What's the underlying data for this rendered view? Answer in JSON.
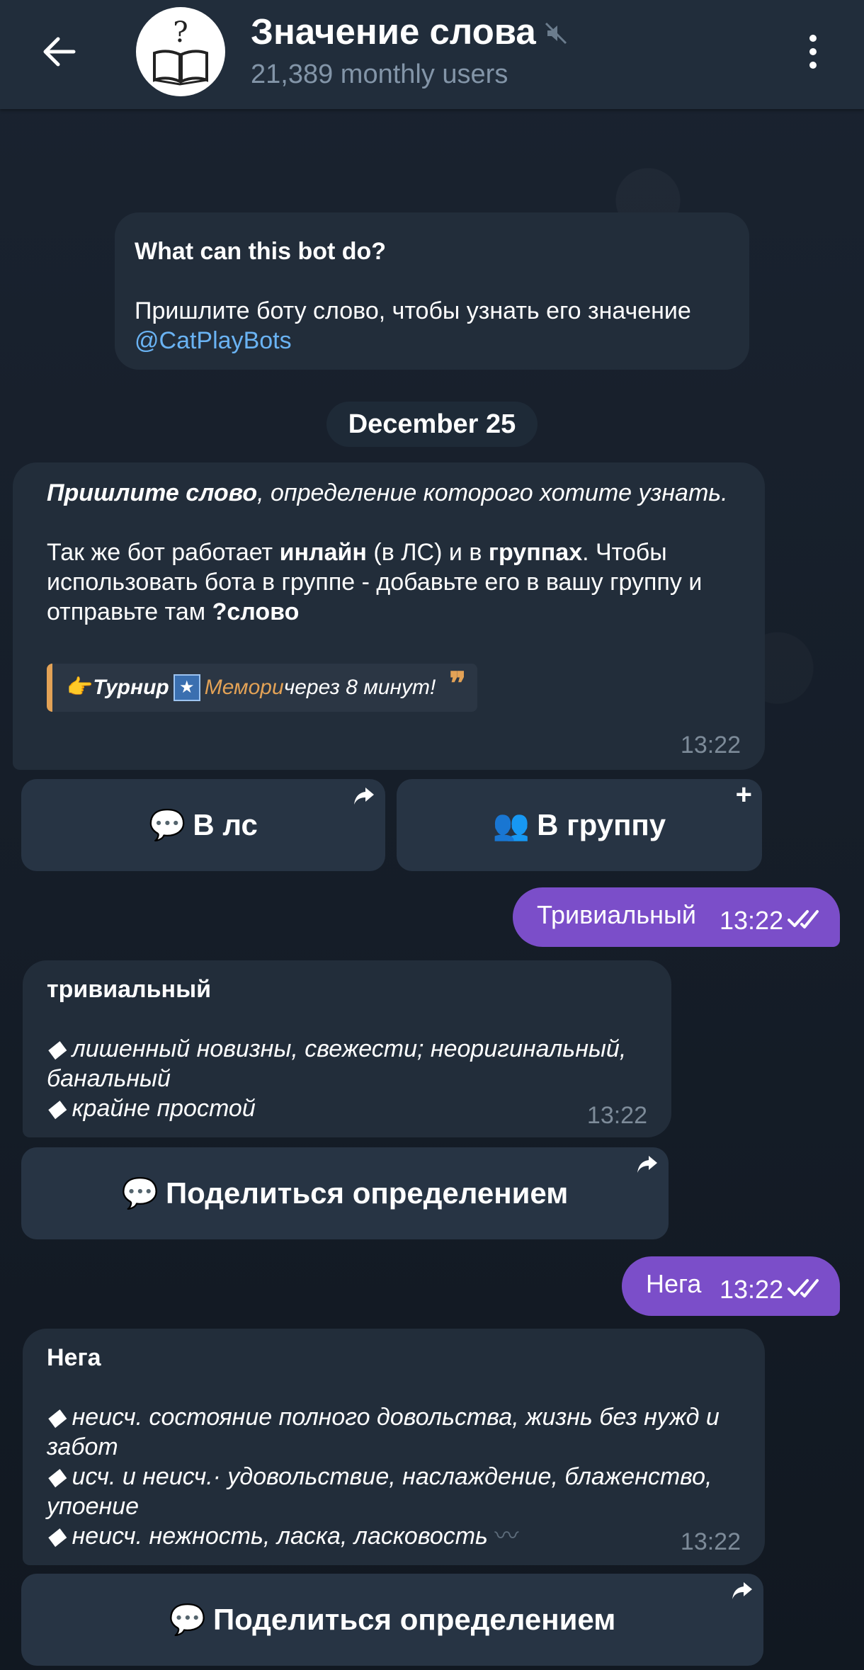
{
  "header": {
    "title": "Значение слова",
    "subtitle": "21,389 monthly users"
  },
  "intro": {
    "heading": "What can this bot do?",
    "text": "Пришлите боту слово, чтобы узнать его значение",
    "link": "@CatPlayBots"
  },
  "date_label": "December 25",
  "msg1": {
    "bold_start": "Пришлите слово",
    "italic_rest": ", определение которого хотите узнать.",
    "p2_a": "Так же бот работает ",
    "p2_b": "инлайн",
    "p2_c": " (в ЛС) и в ",
    "p2_d": "группах",
    "p2_e": ". Чтобы использовать бота в группе - добавьте его в вашу группу и отправьте там ",
    "p2_f": "?слово",
    "quote_a": "Турнир",
    "quote_b": "Мемори",
    "quote_c": " через 8 минут!",
    "time": "13:22"
  },
  "buttons_row1": {
    "dm": "В лс",
    "group": "В группу"
  },
  "out1": {
    "text": "Тривиальный",
    "time": "13:22"
  },
  "msg3": {
    "word": "тривиальный",
    "def1": "лишенный новизны, свежести; неоригинальный, банальный",
    "def2": "крайне простой",
    "time": "13:22"
  },
  "share_button_label": "Поделиться определением",
  "out2": {
    "text": "Нега",
    "time": "13:22"
  },
  "msg5": {
    "word": "Нега",
    "def1": "неисч. состояние полного довольства, жизнь без нужд и забот",
    "def2": "исч. и неисч.· удовольствие, наслаждение, блаженство, упоение",
    "def3": "неисч. нежность, ласка, ласковость",
    "time": "13:22"
  },
  "colors": {
    "header_bg": "#212d3b",
    "incoming_bubble": "#222d3a",
    "outgoing_bubble": "#7b4ec9",
    "link": "#6ab3f3",
    "quote_accent": "#e3a256"
  },
  "icons": [
    "back-arrow-icon",
    "bot-avatar-book-icon",
    "muted-icon",
    "more-vert-icon",
    "forward-icon",
    "plus-icon",
    "speech-bubble-emoji",
    "two-people-emoji",
    "pointing-hand-emoji",
    "sparkle-emoji",
    "double-check-icon"
  ]
}
